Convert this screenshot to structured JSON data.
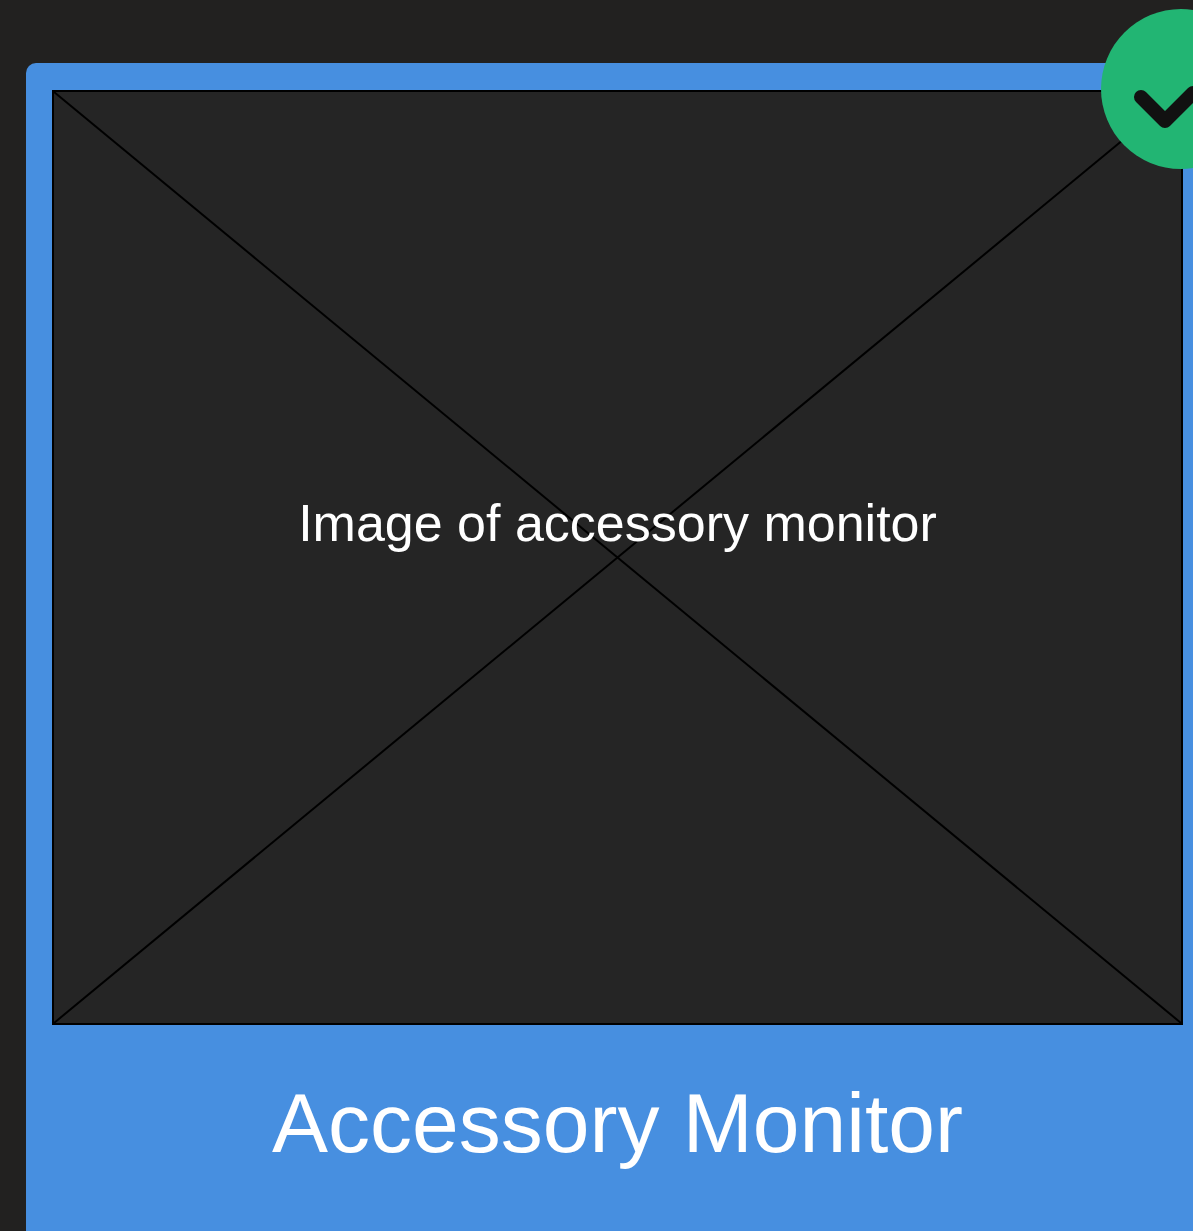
{
  "card": {
    "title": "Accessory Monitor",
    "selected": true,
    "image_caption": "Image of accessory monitor"
  }
}
